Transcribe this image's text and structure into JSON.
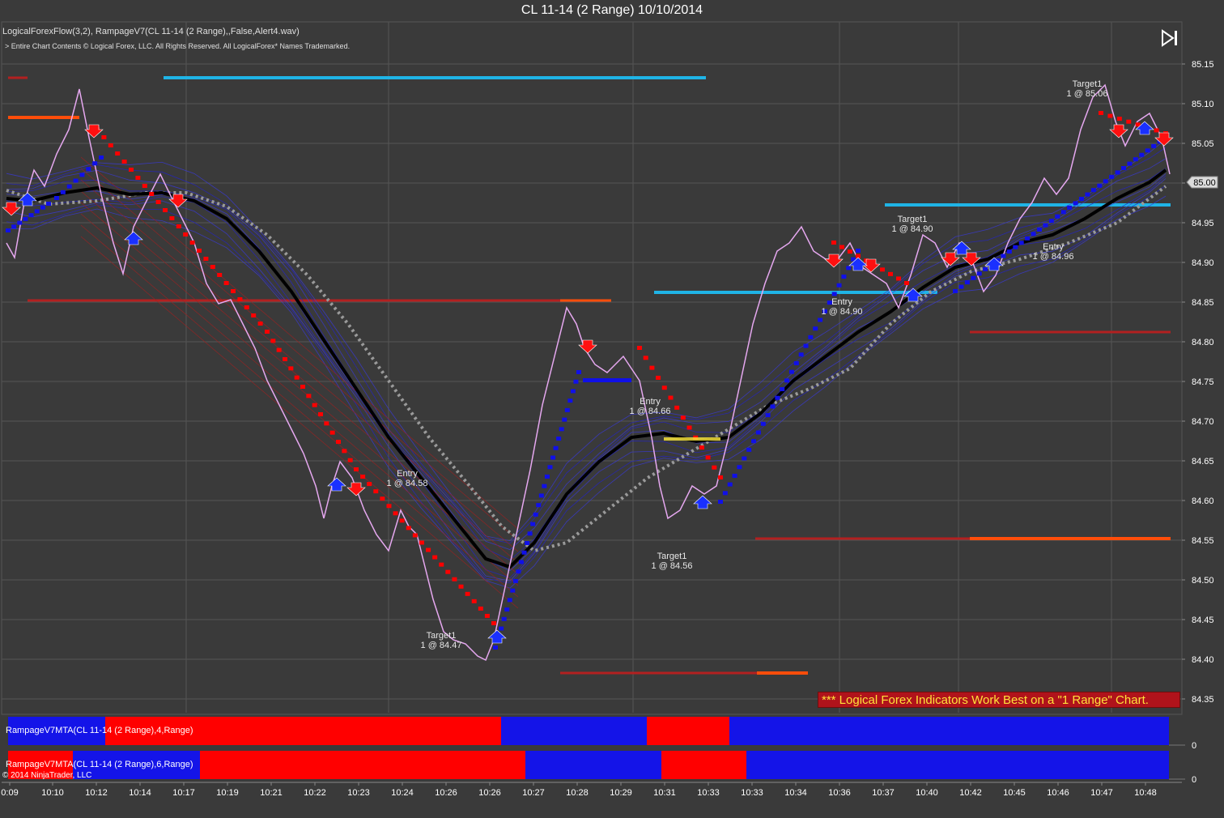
{
  "window": {
    "title": "CL 11-14 (2 Range)  10/10/2014"
  },
  "indicators": {
    "line1": "LogicalForexFlow(3,2), RampageV7(CL 11-14 (2 Range),,False,Alert4.wav)",
    "line2": "> Entire Chart Contents © Logical Forex, LLC. All Rights Reserved. All LogicalForex* Names Trademarked."
  },
  "banner": "*** Logical Forex Indicators Work Best on a \"1 Range\" Chart.",
  "panels": {
    "mta1": "RampageV7MTA(CL 11-14 (2 Range),4,Range)",
    "mta2": "RampageV7MTA(CL 11-14 (2 Range),6,Range)",
    "zero1": "0",
    "zero2": "0",
    "copyright": "© 2014 NinjaTrader, LLC"
  },
  "current_price": "85.00",
  "y_axis_ticks": [
    "85.15",
    "85.10",
    "85.05",
    "85.00",
    "84.95",
    "84.90",
    "84.85",
    "84.80",
    "84.75",
    "84.70",
    "84.65",
    "84.60",
    "84.55",
    "84.50",
    "84.45",
    "84.40",
    "84.35"
  ],
  "x_axis_ticks": [
    "0:09",
    "10:10",
    "10:12",
    "10:14",
    "10:17",
    "10:19",
    "10:21",
    "10:22",
    "10:23",
    "10:24",
    "10:26",
    "10:26",
    "10:27",
    "10:28",
    "10:29",
    "10:31",
    "10:33",
    "10:33",
    "10:34",
    "10:36",
    "10:37",
    "10:40",
    "10:42",
    "10:45",
    "10:46",
    "10:47",
    "10:48"
  ],
  "annotations": [
    {
      "t1": "Entry",
      "t2": "1 @ 84.58"
    },
    {
      "t1": "Target1",
      "t2": "1 @ 84.47"
    },
    {
      "t1": "Entry",
      "t2": "1 @ 84.66"
    },
    {
      "t1": "Target1",
      "t2": "1 @ 84.56"
    },
    {
      "t1": "Entry",
      "t2": "1 @ 84.90"
    },
    {
      "t1": "Target1",
      "t2": "1 @ 84.90"
    },
    {
      "t1": "Entry",
      "t2": "1 @ 84.96"
    },
    {
      "t1": "Target1",
      "t2": "1 @ 85.06"
    }
  ],
  "colors": {
    "background": "#3a3a3a",
    "price_line": "#e6a8f0",
    "bull": "#1010e8",
    "bear": "#ff0000",
    "slow_ma": "#000000",
    "dotted_ma": "#9a9a9a"
  },
  "icons": {
    "skip": "skip-to-end-icon"
  }
}
